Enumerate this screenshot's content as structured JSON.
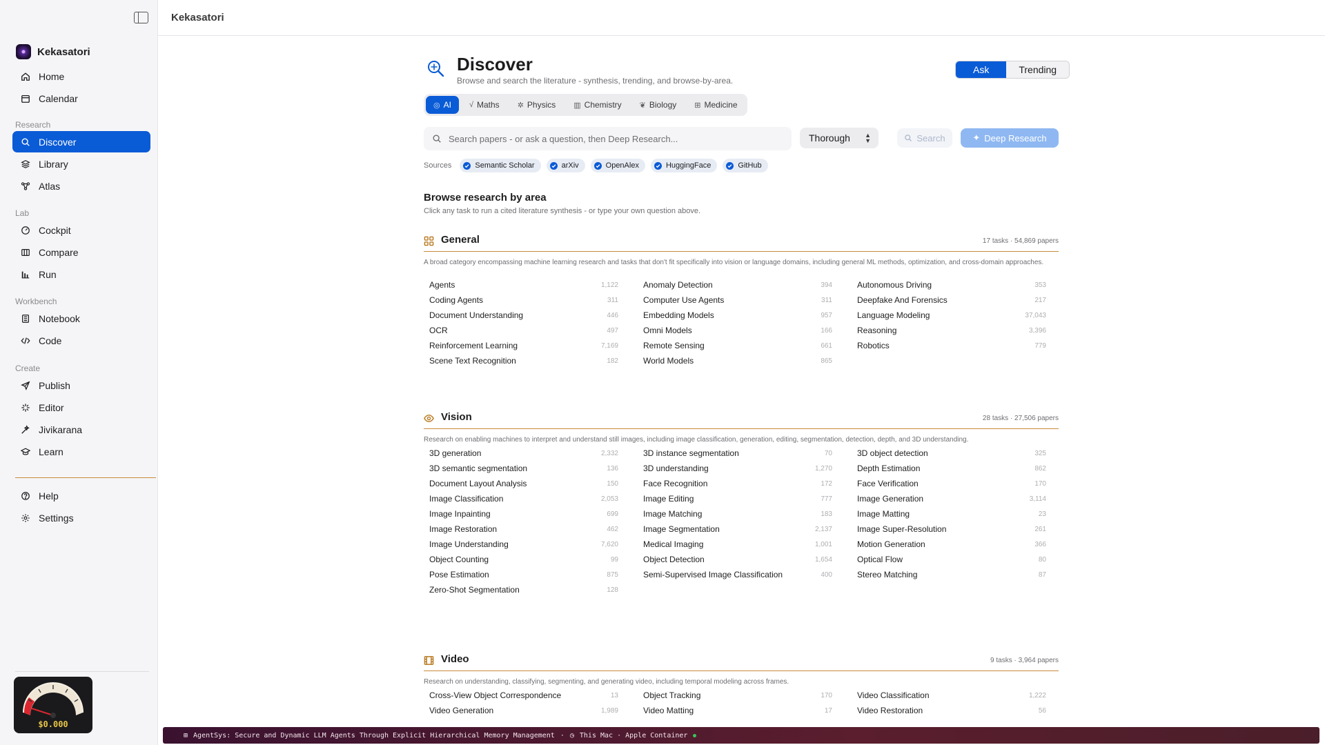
{
  "app": {
    "name": "Kekasatori",
    "header_title": "Kekasatori"
  },
  "nav": {
    "sections": {
      "research": "Research",
      "lab": "Lab",
      "workbench": "Workbench",
      "create": "Create"
    },
    "home": "Home",
    "calendar": "Calendar",
    "discover": "Discover",
    "library": "Library",
    "atlas": "Atlas",
    "cockpit": "Cockpit",
    "compare": "Compare",
    "run": "Run",
    "notebook": "Notebook",
    "code": "Code",
    "publish": "Publish",
    "editor": "Editor",
    "jivikarana": "Jivikarana",
    "learn": "Learn",
    "help": "Help",
    "settings": "Settings"
  },
  "gauge": {
    "label": "$0.000"
  },
  "page": {
    "title": "Discover",
    "subtitle": "Browse and search the literature - synthesis, trending, and browse-by-area.",
    "modes": [
      "Ask",
      "Trending"
    ]
  },
  "domains": [
    "AI",
    "Maths",
    "Physics",
    "Chemistry",
    "Biology",
    "Medicine"
  ],
  "search": {
    "placeholder": "Search papers - or ask a question, then Deep Research...",
    "depth": "Thorough",
    "search_label": "Search",
    "deep_research_label": "Deep Research"
  },
  "sources": {
    "label": "Sources",
    "items": [
      "Semantic Scholar",
      "arXiv",
      "OpenAlex",
      "HuggingFace",
      "GitHub"
    ]
  },
  "browse": {
    "title": "Browse research by area",
    "subtitle": "Click any task to run a cited literature synthesis - or type your own question above."
  },
  "areas": {
    "general": {
      "name": "General",
      "stats": "17 tasks · 54,869 papers",
      "desc": "A broad category encompassing machine learning research and tasks that don't fit specifically into vision or language domains, including general ML methods, optimization, and cross-domain approaches.",
      "tasks": [
        [
          "Agents",
          "1,122"
        ],
        [
          "Anomaly Detection",
          "394"
        ],
        [
          "Autonomous Driving",
          "353"
        ],
        [
          "Coding Agents",
          "311"
        ],
        [
          "Computer Use Agents",
          "311"
        ],
        [
          "Deepfake And Forensics",
          "217"
        ],
        [
          "Document Understanding",
          "446"
        ],
        [
          "Embedding Models",
          "957"
        ],
        [
          "Language Modeling",
          "37,043"
        ],
        [
          "OCR",
          "497"
        ],
        [
          "Omni Models",
          "166"
        ],
        [
          "Reasoning",
          "3,396"
        ],
        [
          "Reinforcement Learning",
          "7,169"
        ],
        [
          "Remote Sensing",
          "661"
        ],
        [
          "Robotics",
          "779"
        ],
        [
          "Scene Text Recognition",
          "182"
        ],
        [
          "World Models",
          "865"
        ]
      ]
    },
    "vision": {
      "name": "Vision",
      "stats": "28 tasks · 27,506 papers",
      "desc": "Research on enabling machines to interpret and understand still images, including image classification, generation, editing, segmentation, detection, depth, and 3D understanding.",
      "tasks": [
        [
          "3D generation",
          "2,332"
        ],
        [
          "3D instance segmentation",
          "70"
        ],
        [
          "3D object detection",
          "325"
        ],
        [
          "3D semantic segmentation",
          "136"
        ],
        [
          "3D understanding",
          "1,270"
        ],
        [
          "Depth Estimation",
          "862"
        ],
        [
          "Document Layout Analysis",
          "150"
        ],
        [
          "Face Recognition",
          "172"
        ],
        [
          "Face Verification",
          "170"
        ],
        [
          "Image Classification",
          "2,053"
        ],
        [
          "Image Editing",
          "777"
        ],
        [
          "Image Generation",
          "3,114"
        ],
        [
          "Image Inpainting",
          "699"
        ],
        [
          "Image Matching",
          "183"
        ],
        [
          "Image Matting",
          "23"
        ],
        [
          "Image Restoration",
          "462"
        ],
        [
          "Image Segmentation",
          "2,137"
        ],
        [
          "Image Super-Resolution",
          "261"
        ],
        [
          "Image Understanding",
          "7,620"
        ],
        [
          "Medical Imaging",
          "1,001"
        ],
        [
          "Motion Generation",
          "366"
        ],
        [
          "Object Counting",
          "99"
        ],
        [
          "Object Detection",
          "1,654"
        ],
        [
          "Optical Flow",
          "80"
        ],
        [
          "Pose Estimation",
          "875"
        ],
        [
          "Semi-Supervised Image Classification",
          "400"
        ],
        [
          "Stereo Matching",
          "87"
        ],
        [
          "Zero-Shot Segmentation",
          "128"
        ]
      ]
    },
    "video": {
      "name": "Video",
      "stats": "9 tasks · 3,964 papers",
      "desc": "Research on understanding, classifying, segmenting, and generating video, including temporal modeling across frames.",
      "tasks": [
        [
          "Cross-View Object Correspondence",
          "13"
        ],
        [
          "Object Tracking",
          "170"
        ],
        [
          "Video Classification",
          "1,222"
        ],
        [
          "Video Generation",
          "1,989"
        ],
        [
          "Video Matting",
          "17"
        ],
        [
          "Video Restoration",
          "56"
        ]
      ]
    }
  },
  "statusbar": {
    "paper": "AgentSys: Secure and Dynamic LLM Agents Through Explicit Hierarchical Memory Management",
    "separator": "·",
    "host": "This Mac · Apple Container"
  },
  "colors": {
    "accent": "#0a5bd6",
    "area_accent": "#c98a3a",
    "status_bg": "#4a1830"
  }
}
